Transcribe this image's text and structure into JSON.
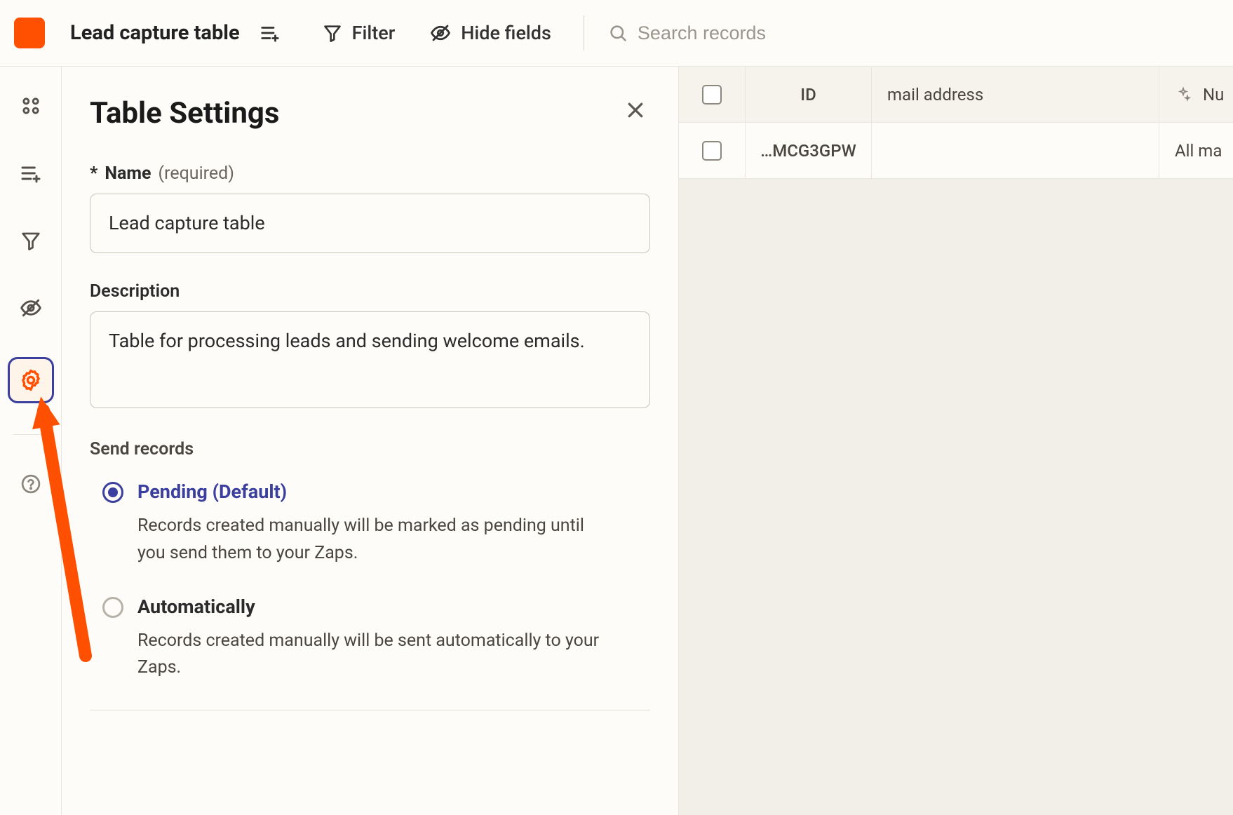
{
  "toolbar": {
    "table_title": "Lead capture table",
    "filter_label": "Filter",
    "hide_fields_label": "Hide fields",
    "search_placeholder": "Search records"
  },
  "settings_panel": {
    "title": "Table Settings",
    "name_field": {
      "label_prefix": "*",
      "label": "Name",
      "hint": "(required)",
      "value": "Lead capture table"
    },
    "description_field": {
      "label": "Description",
      "value": "Table for processing leads and sending welcome emails."
    },
    "send_records": {
      "section_label": "Send records",
      "options": [
        {
          "title": "Pending (Default)",
          "desc": "Records created manually will be marked as pending until you send them to your Zaps.",
          "selected": true
        },
        {
          "title": "Automatically",
          "desc": "Records created manually will be sent automatically to your Zaps.",
          "selected": false
        }
      ]
    }
  },
  "table": {
    "columns": {
      "id": "ID",
      "email": "mail address",
      "nu": "Nu"
    },
    "rows": [
      {
        "id": "…MCG3GPW",
        "email": "",
        "nu": "All ma"
      }
    ]
  }
}
